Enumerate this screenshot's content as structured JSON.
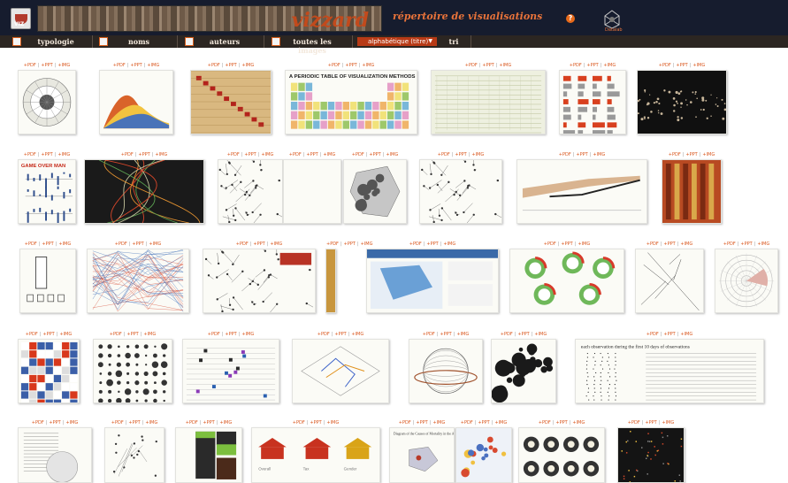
{
  "header": {
    "banner_title": "vizzard",
    "subtitle": "répertoire de visualisations",
    "logo_text": "VIZ",
    "partner_label": "Datalab"
  },
  "toolbar": {
    "items": [
      {
        "label": "typologie",
        "checked": false
      },
      {
        "label": "noms",
        "checked": false
      },
      {
        "label": "auteurs",
        "checked": false
      },
      {
        "label": "toutes les images",
        "checked": false
      }
    ],
    "sort_select": "alphabétique (titre)",
    "sort_button": "tri"
  },
  "link_labels": {
    "pdf": "+PDF",
    "ppt": "+PPT",
    "img": "+IMG"
  },
  "thumbnails": {
    "periodic_table_title": "A PERIODIC TABLE OF VISUALIZATION METHODS",
    "game_over_title": "GAME OVER MAN",
    "mortality_title": "Diagram of the Causes of Mortality in the Army in the East",
    "observation_title": "each observation during the first 10 days of observations",
    "house_labels": [
      "Overall",
      "Tax",
      "Gender"
    ]
  }
}
